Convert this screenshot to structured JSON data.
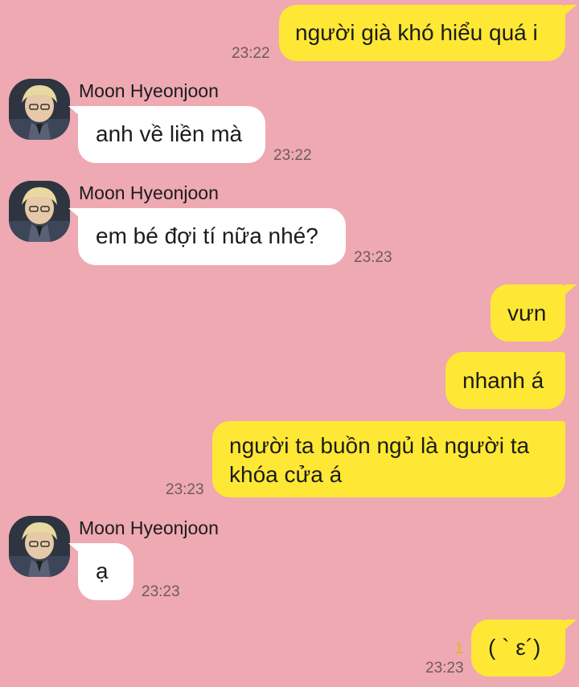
{
  "contact": {
    "name": "Moon Hyeonjoon"
  },
  "messages": [
    {
      "sender": "me",
      "text": "người già khó hiểu quá i",
      "time": "23:22"
    },
    {
      "sender": "them",
      "name": "Moon Hyeonjoon",
      "text": "anh về liền mà",
      "time": "23:22"
    },
    {
      "sender": "them",
      "name": "Moon Hyeonjoon",
      "text": "em bé đợi tí nữa nhé?",
      "time": "23:23"
    },
    {
      "sender": "me",
      "text": "vưn"
    },
    {
      "sender": "me",
      "text": "nhanh á"
    },
    {
      "sender": "me",
      "line1": "người ta buồn ngủ là người ta",
      "line2": "khóa cửa á",
      "time": "23:23"
    },
    {
      "sender": "them",
      "name": "Moon Hyeonjoon",
      "text": "ạ",
      "time": "23:23"
    },
    {
      "sender": "me",
      "text": "( ` ε´)",
      "time": "23:23",
      "unread": "1"
    }
  ],
  "colors": {
    "background": "#EEA9B2",
    "my_bubble": "#FFE835",
    "their_bubble": "#FFFFFF",
    "unread_count": "#E6B800"
  },
  "icons": {
    "avatar": "profile-photo"
  }
}
